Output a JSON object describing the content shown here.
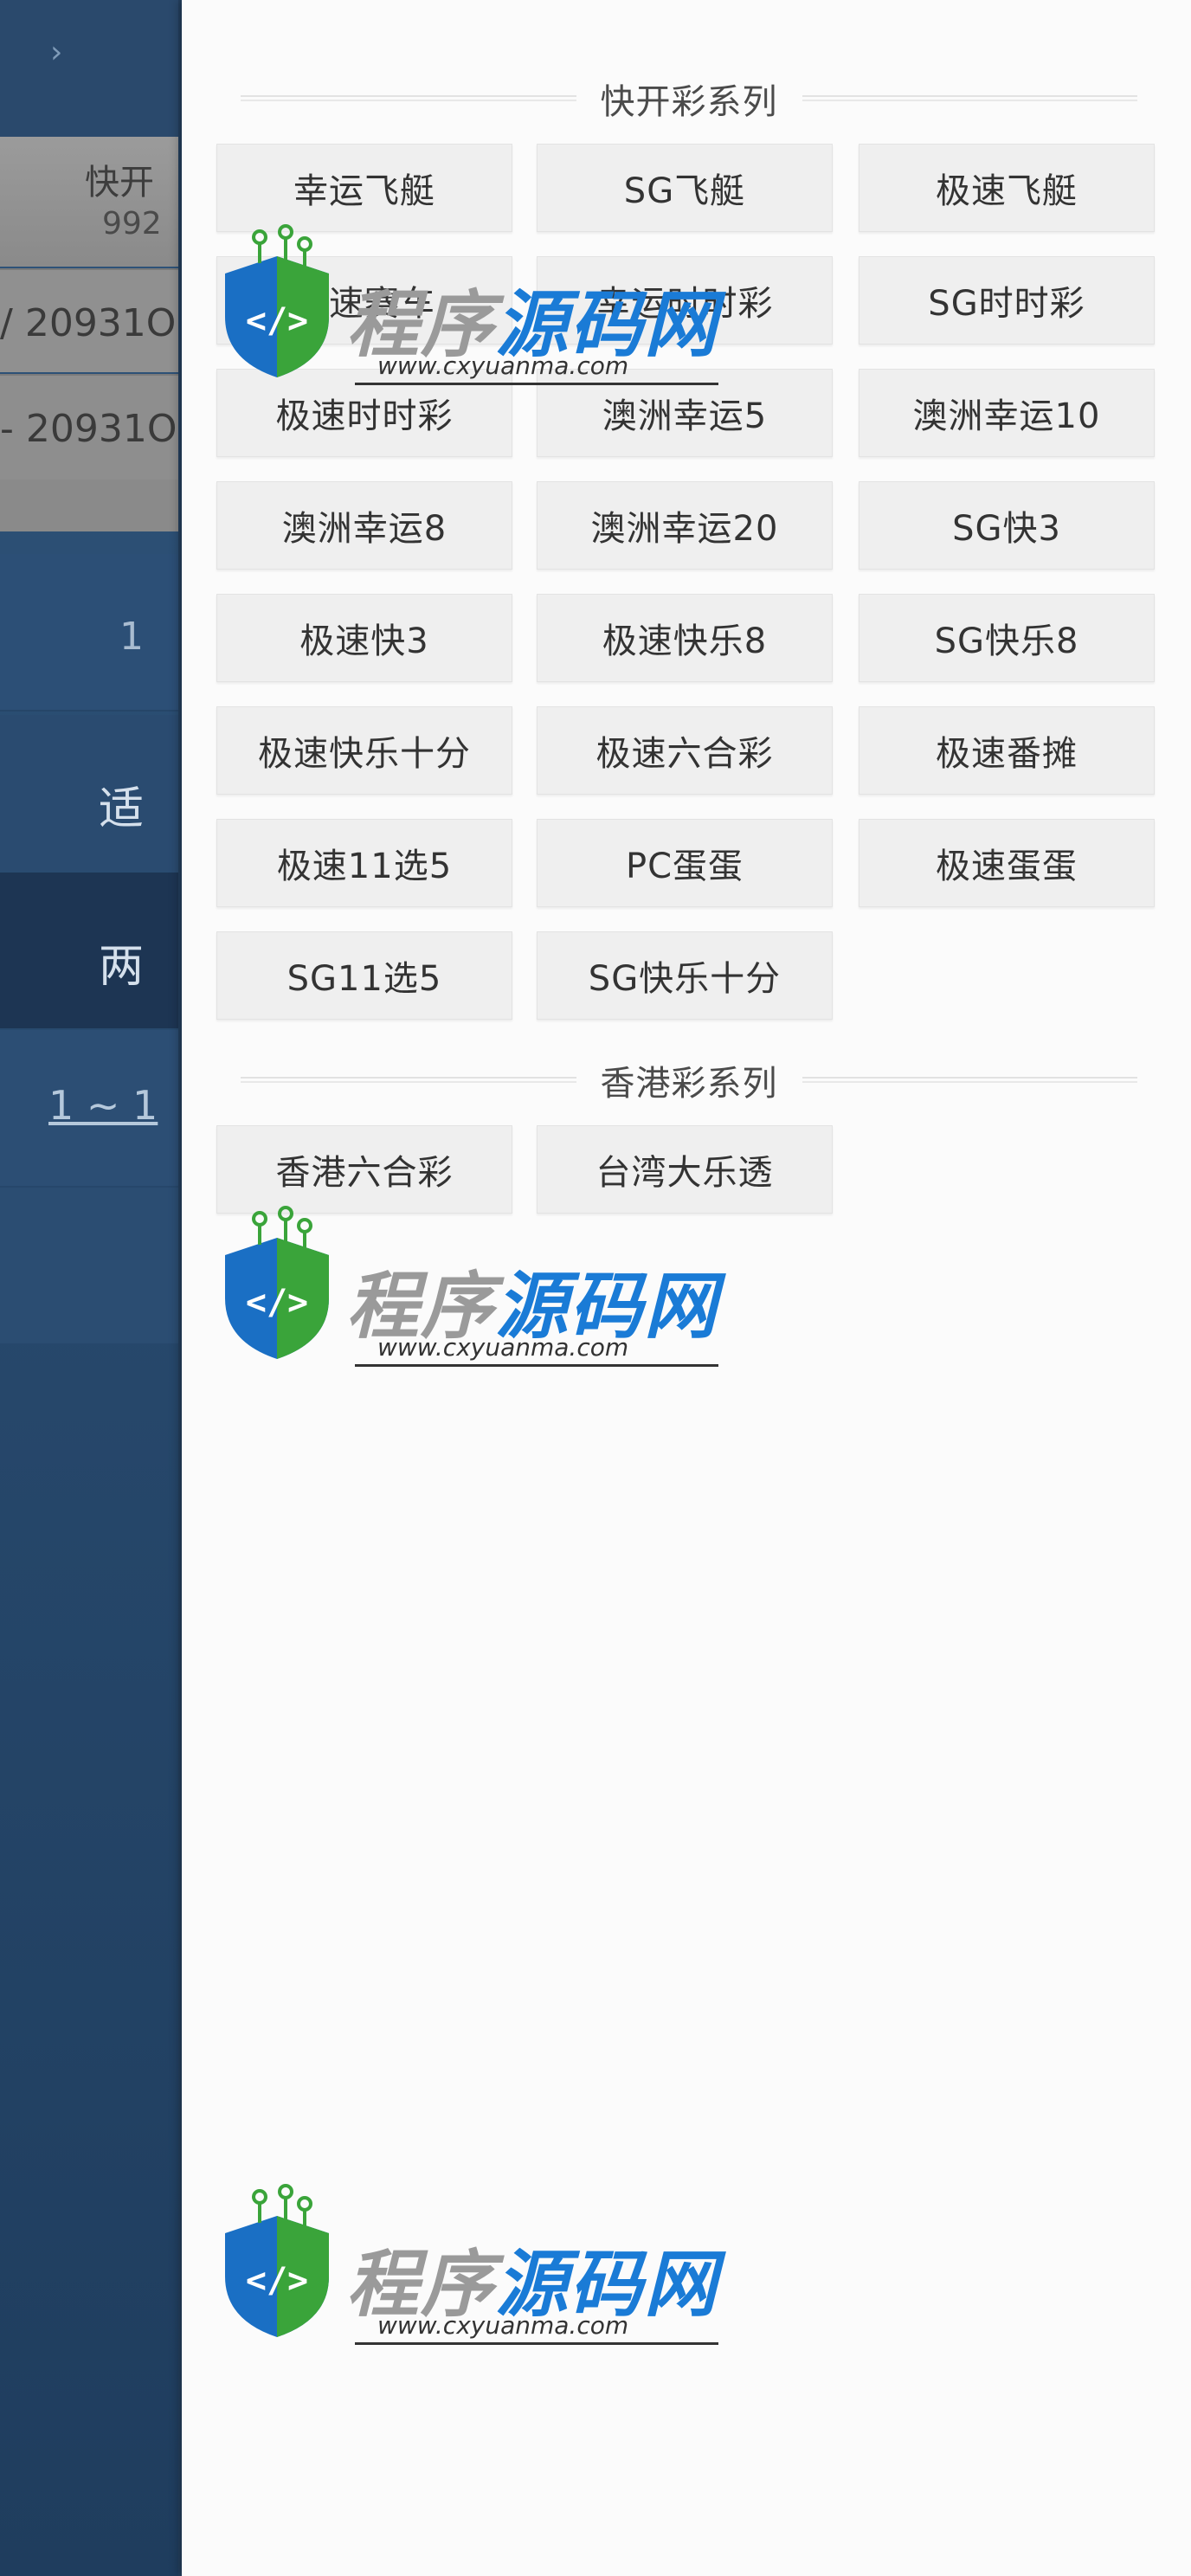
{
  "background": {
    "row1_line1": "快开",
    "row1_line2": "992",
    "row2_text": "20931O",
    "row3_text": "20931O",
    "row2_prefix": "/",
    "row3_prefix": "-",
    "nav_item1": "适",
    "nav_item2": "两",
    "nav_item3": "1",
    "pager_text": "1 ~ 1"
  },
  "panel": {
    "section_quick": {
      "title": "快开彩系列",
      "items": [
        "幸运飞艇",
        "SG飞艇",
        "极速飞艇",
        "极速赛车",
        "幸运时时彩",
        "SG时时彩",
        "极速时时彩",
        "澳洲幸运5",
        "澳洲幸运10",
        "澳洲幸运8",
        "澳洲幸运20",
        "SG快3",
        "极速快3",
        "极速快乐8",
        "SG快乐8",
        "极速快乐十分",
        "极速六合彩",
        "极速番摊",
        "极速11选5",
        "PC蛋蛋",
        "极速蛋蛋",
        "SG11选5",
        "SG快乐十分"
      ]
    },
    "section_hk": {
      "title": "香港彩系列",
      "items": [
        "香港六合彩",
        "台湾大乐透"
      ]
    }
  },
  "watermark": {
    "brand_gray": "程序",
    "brand_blue": "源码网",
    "url": "www.cxyuanma.com"
  },
  "colors": {
    "panel_bg": "#fbfbfb",
    "button_bg": "#efefef",
    "sidebar_blue": "#2b4d72",
    "watermark_blue": "#1a7bd6",
    "watermark_green": "#3aa43a"
  }
}
